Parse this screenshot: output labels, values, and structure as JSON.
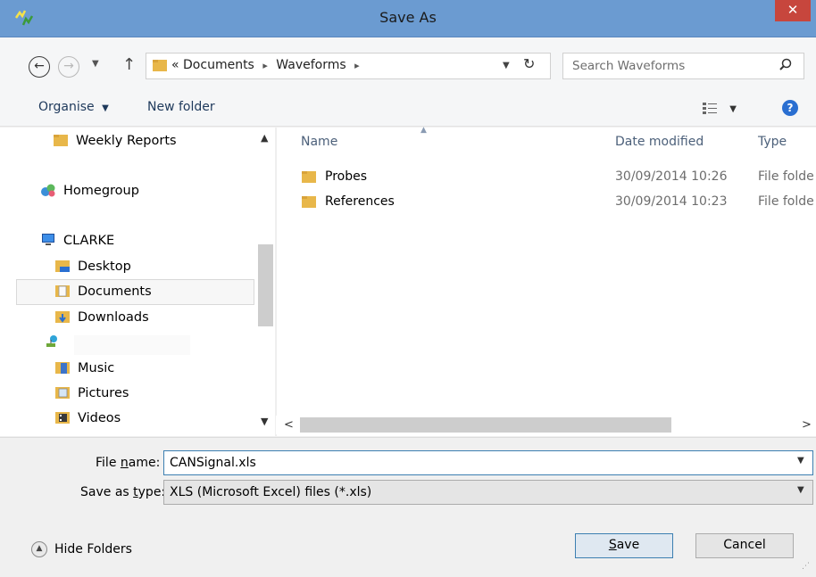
{
  "window": {
    "title": "Save As",
    "close_label": "✕"
  },
  "address": {
    "overflow": "«",
    "path": [
      "Documents",
      "Waveforms"
    ],
    "separator": "▸"
  },
  "search": {
    "placeholder": "Search Waveforms"
  },
  "toolbar": {
    "organise_label": "Organise",
    "new_folder_label": "New folder"
  },
  "nav": {
    "items": [
      {
        "label": "Weekly Reports",
        "icon": "folder-icon"
      },
      {
        "label": "Homegroup",
        "icon": "homegroup-icon"
      },
      {
        "label": "CLARKE",
        "icon": "computer-icon"
      },
      {
        "label": "Desktop",
        "icon": "desktop-icon"
      },
      {
        "label": "Documents",
        "icon": "documents-icon",
        "selected": true
      },
      {
        "label": "Downloads",
        "icon": "downloads-icon"
      },
      {
        "label": "",
        "icon": "network-drive-icon"
      },
      {
        "label": "Music",
        "icon": "music-icon"
      },
      {
        "label": "Pictures",
        "icon": "pictures-icon"
      },
      {
        "label": "Videos",
        "icon": "videos-icon"
      }
    ]
  },
  "files": {
    "columns": {
      "name": "Name",
      "date": "Date modified",
      "type": "Type"
    },
    "rows": [
      {
        "name": "Probes",
        "date": "30/09/2014 10:26",
        "type": "File folde"
      },
      {
        "name": "References",
        "date": "30/09/2014 10:23",
        "type": "File folde"
      }
    ]
  },
  "form": {
    "filename_label_pre": "File ",
    "filename_label_access": "n",
    "filename_label_post": "ame:",
    "filename_value": "CANSignal.xls",
    "type_label_pre": "Save as ",
    "type_label_access": "t",
    "type_label_post": "ype:",
    "type_value": "XLS (Microsoft Excel) files (*.xls)"
  },
  "footer": {
    "hide_folders_label": "Hide Folders",
    "save_access": "S",
    "save_rest": "ave",
    "cancel_label": "Cancel"
  },
  "colors": {
    "titlebar": "#6b9bd1",
    "close": "#c7463d",
    "link": "#1e395b",
    "folder": "#e8b74a"
  }
}
